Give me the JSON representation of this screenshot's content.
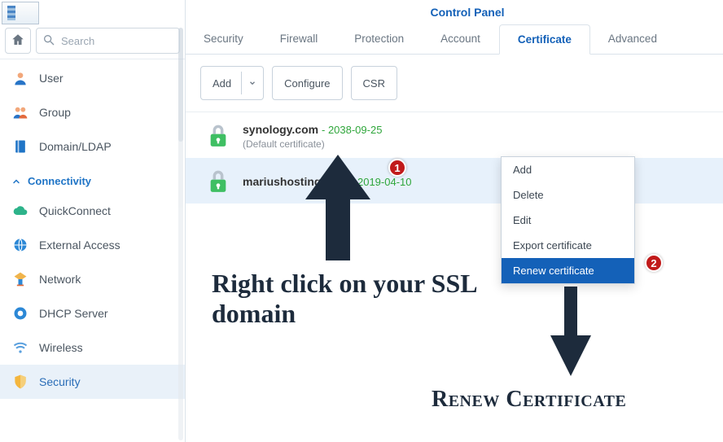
{
  "window": {
    "title": "Control Panel"
  },
  "search": {
    "placeholder": "Search"
  },
  "sidebar": {
    "items": [
      {
        "label": "User"
      },
      {
        "label": "Group"
      },
      {
        "label": "Domain/LDAP"
      }
    ],
    "section_label": "Connectivity",
    "conn_items": [
      {
        "label": "QuickConnect"
      },
      {
        "label": "External Access"
      },
      {
        "label": "Network"
      },
      {
        "label": "DHCP Server"
      },
      {
        "label": "Wireless"
      },
      {
        "label": "Security"
      }
    ]
  },
  "tabs": {
    "items": [
      {
        "label": "Security"
      },
      {
        "label": "Firewall"
      },
      {
        "label": "Protection"
      },
      {
        "label": "Account"
      },
      {
        "label": "Certificate"
      },
      {
        "label": "Advanced"
      }
    ]
  },
  "toolbar": {
    "add_label": "Add",
    "configure_label": "Configure",
    "csr_label": "CSR"
  },
  "certs": [
    {
      "name": "synology.com",
      "expiry": "2038-09-25",
      "note": "(Default certificate)"
    },
    {
      "name": "mariushosting.com",
      "expiry": "2019-04-10"
    }
  ],
  "context_menu": {
    "items": [
      {
        "label": "Add"
      },
      {
        "label": "Delete"
      },
      {
        "label": "Edit"
      },
      {
        "label": "Export certificate"
      },
      {
        "label": "Renew certificate"
      }
    ]
  },
  "annotations": {
    "badge1": "1",
    "badge2": "2",
    "text1": "Right click on your SSL domain",
    "text2": "Renew Certificate"
  }
}
